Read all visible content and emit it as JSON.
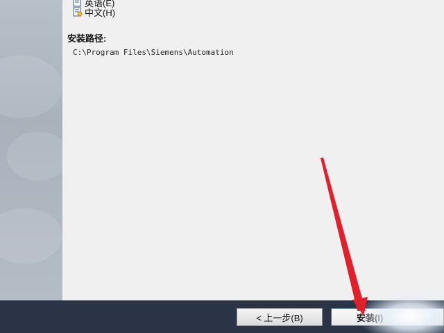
{
  "language_options": [
    {
      "label": "英语(E)"
    },
    {
      "label": "中文(H)"
    }
  ],
  "install_path": {
    "label": "安装路径:",
    "value": "C:\\Program Files\\Siemens\\Automation"
  },
  "footer": {
    "back_label": "< 上一步(B)",
    "install_label": "安装(I)"
  },
  "colors": {
    "footer_bg": "#2a3446",
    "arrow": "#e0202a",
    "content_bg": "#f0f0f0"
  }
}
